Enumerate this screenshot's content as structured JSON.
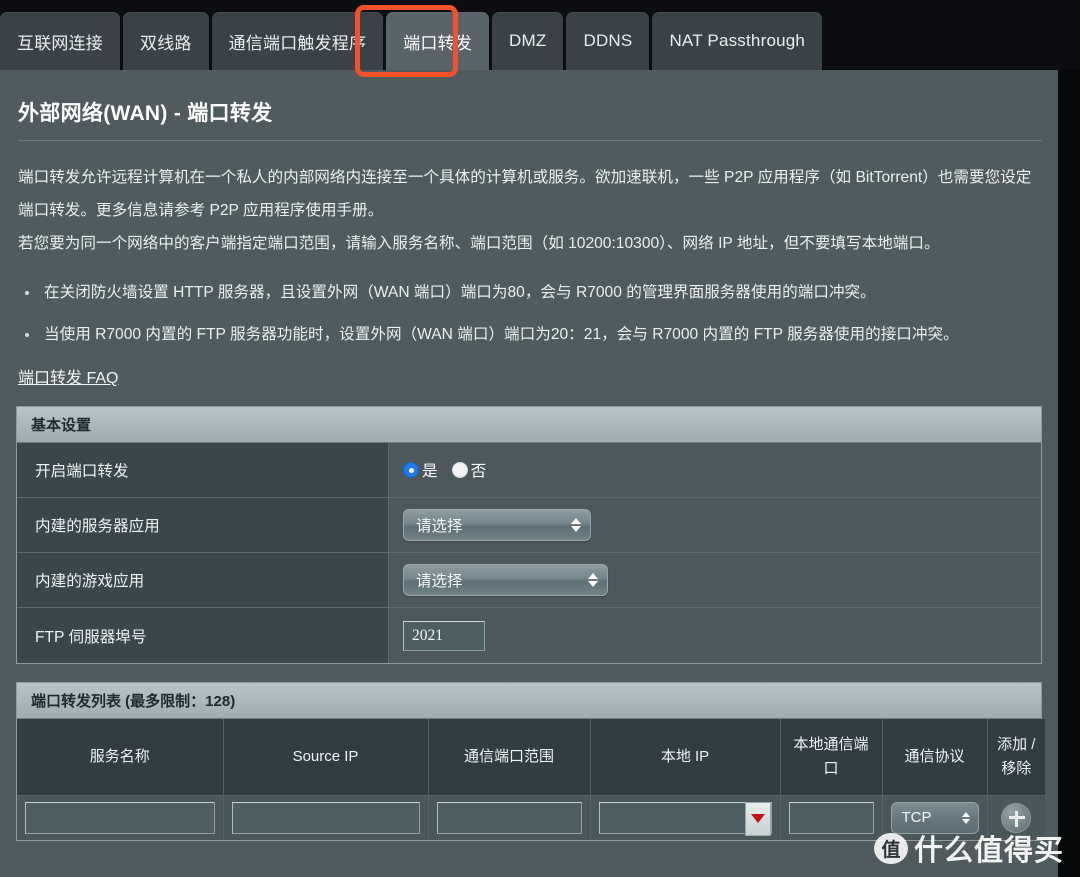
{
  "tabs": [
    {
      "label": "互联网连接",
      "active": false
    },
    {
      "label": "双线路",
      "active": false
    },
    {
      "label": "通信端口触发程序",
      "active": false
    },
    {
      "label": "端口转发",
      "active": true
    },
    {
      "label": "DMZ",
      "active": false
    },
    {
      "label": "DDNS",
      "active": false
    },
    {
      "label": "NAT Passthrough",
      "active": false
    }
  ],
  "highlight_color": "#f4502a",
  "page": {
    "title": "外部网络(WAN) - 端口转发",
    "paragraphs": [
      "端口转发允许远程计算机在一个私人的内部网络内连接至一个具体的计算机或服务。欲加速联机，一些 P2P 应用程序（如 BitTorrent）也需要您设定端口转发。更多信息请参考 P2P 应用程序使用手册。",
      "若您要为同一个网络中的客户端指定端口范围，请输入服务名称、端口范围（如 10200:10300）、网络 IP 地址，但不要填写本地端口。"
    ],
    "bullets": [
      "在关闭防火墙设置 HTTP 服务器，且设置外网（WAN 端口）端口为80，会与 R7000 的管理界面服务器使用的端口冲突。",
      "当使用 R7000 内置的 FTP 服务器功能时，设置外网（WAN 端口）端口为20：21，会与 R7000 内置的 FTP 服务器使用的接口冲突。"
    ],
    "faq_link": "端口转发 FAQ"
  },
  "basic_settings": {
    "header": "基本设置",
    "rows": [
      {
        "label": "开启端口转发",
        "type": "radio",
        "options": [
          {
            "label": "是",
            "checked": true
          },
          {
            "label": "否",
            "checked": false
          }
        ]
      },
      {
        "label": "内建的服务器应用",
        "type": "select",
        "value": "请选择"
      },
      {
        "label": "内建的游戏应用",
        "type": "select",
        "value": "请选择"
      },
      {
        "label": "FTP 伺服器埠号",
        "type": "text",
        "value": "2021"
      }
    ]
  },
  "forward_list": {
    "header": "端口转发列表 (最多限制：128)",
    "columns": [
      "服务名称",
      "Source IP",
      "通信端口范围",
      "本地 IP",
      "本地通信端口",
      "通信协议",
      "添加 / 移除"
    ],
    "new_row": {
      "service_name": "",
      "source_ip": "",
      "port_range": "",
      "local_ip": "",
      "local_port": "",
      "protocol": "TCP",
      "action": "add"
    }
  },
  "watermark": {
    "logo": "值",
    "text": "什么值得买"
  }
}
